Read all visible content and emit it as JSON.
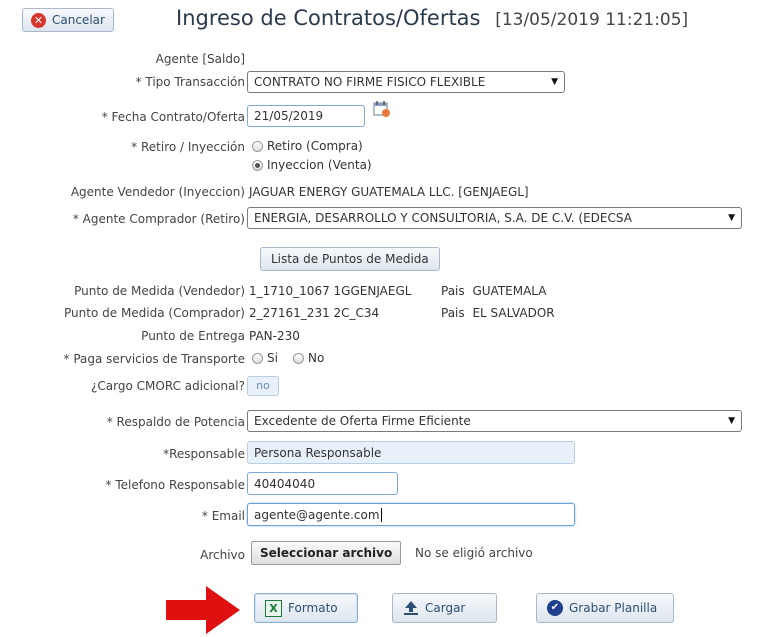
{
  "header": {
    "cancel_label": "Cancelar",
    "title": "Ingreso de Contratos/Ofertas",
    "timestamp": "[13/05/2019 11:21:05]"
  },
  "form": {
    "agente_saldo": "Agente [Saldo]",
    "tipo_transaccion": {
      "label": "* Tipo Transacción",
      "value": "CONTRATO NO FIRME FISICO FLEXIBLE"
    },
    "fecha": {
      "label": "* Fecha Contrato/Oferta",
      "value": "21/05/2019"
    },
    "retiro_inyeccion": {
      "label": "* Retiro / Inyección",
      "options": [
        "Retiro (Compra)",
        "Inyeccion (Venta)"
      ],
      "selected": "Inyeccion (Venta)"
    },
    "agente_vendedor": {
      "label": "Agente Vendedor (Inyeccion)",
      "value": "JAGUAR ENERGY GUATEMALA LLC. [GENJAEGL]"
    },
    "agente_comprador": {
      "label": "* Agente Comprador (Retiro)",
      "value": "ENERGIA, DESARROLLO Y CONSULTORIA, S.A. DE C.V. (EDECSA"
    },
    "lista_puntos_label": "Lista de Puntos de Medida",
    "punto_vendedor": {
      "label": "Punto de Medida (Vendedor)",
      "value": "1_1710_1067 1GGENJAEGL",
      "pais_label": "Pais",
      "pais": "GUATEMALA"
    },
    "punto_comprador": {
      "label": "Punto de Medida (Comprador)",
      "value": "2_27161_231 2C_C34",
      "pais_label": "Pais",
      "pais": "EL SALVADOR"
    },
    "punto_entrega": {
      "label": "Punto de Entrega",
      "value": "PAN-230"
    },
    "paga_transporte": {
      "label": "* Paga servicios de Transporte",
      "options": [
        "Si",
        "No"
      ]
    },
    "cargo_cmorc": {
      "label": "¿Cargo CMORC adicional?",
      "value": "no"
    },
    "respaldo": {
      "label": "* Respaldo de Potencia",
      "value": "Excedente de Oferta Firme Eficiente"
    },
    "responsable": {
      "label": "*Responsable",
      "value": "Persona Responsable"
    },
    "telefono": {
      "label": "* Telefono Responsable",
      "value": "40404040"
    },
    "email": {
      "label": "* Email",
      "value": "agente@agente.com"
    },
    "archivo": {
      "label": "Archivo",
      "button": "Seleccionar archivo",
      "status": "No se eligió archivo"
    }
  },
  "footer": {
    "formato_label": "Formato",
    "cargar_label": "Cargar",
    "grabar_label": "Grabar Planilla"
  },
  "colors": {
    "accent": "#2d4f73",
    "arrow": "#e01010",
    "cancel_icon": "#d9342b"
  }
}
